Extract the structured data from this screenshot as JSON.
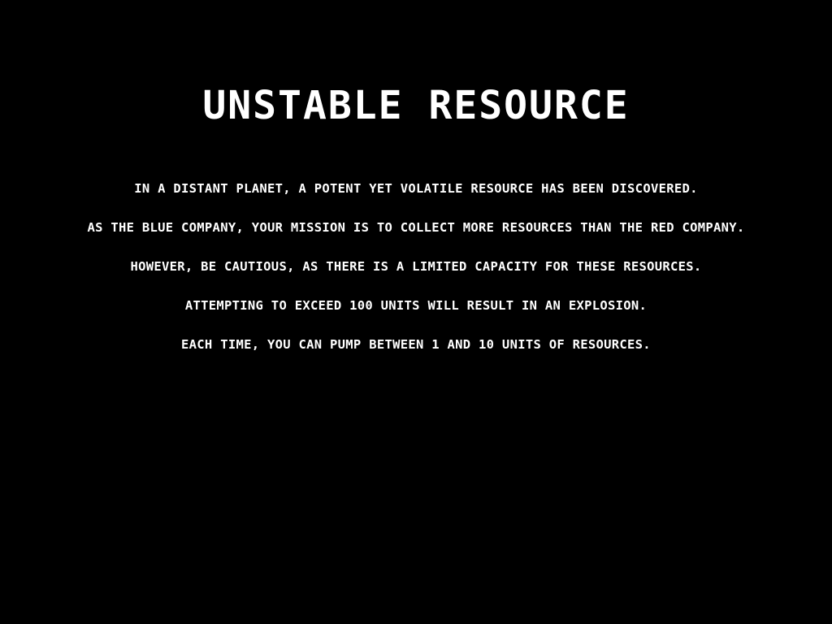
{
  "title": "UNSTABLE RESOURCE",
  "story": [
    "IN A DISTANT PLANET, A POTENT YET VOLATILE RESOURCE HAS BEEN DISCOVERED.",
    "AS THE BLUE COMPANY, YOUR MISSION IS TO COLLECT MORE RESOURCES THAN THE RED COMPANY.",
    "HOWEVER, BE CAUTIOUS, AS THERE IS A LIMITED CAPACITY FOR THESE RESOURCES.",
    "ATTEMPTING TO EXCEED 100 UNITS WILL RESULT IN AN EXPLOSION.",
    "EACH TIME, YOU CAN PUMP BETWEEN 1 AND 10 UNITS OF RESOURCES."
  ],
  "colors": {
    "background": "#000000",
    "text": "#ffffff"
  }
}
